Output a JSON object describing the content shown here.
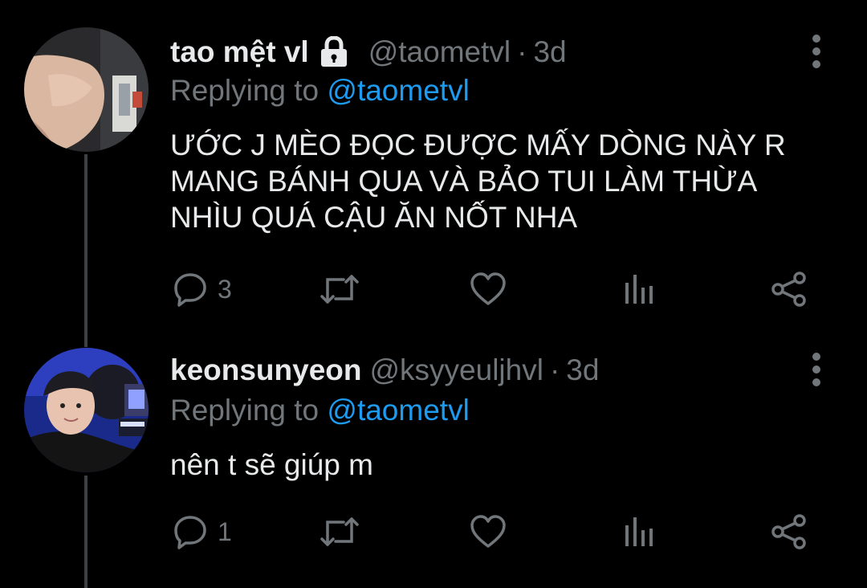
{
  "colors": {
    "background": "#000000",
    "text_primary": "#e7e9ea",
    "text_secondary": "#71767b",
    "accent": "#1d9bf0",
    "thread_line": "#3d4146"
  },
  "tweets": [
    {
      "display_name": "tao mệt vl",
      "locked": true,
      "handle": "@taometvl",
      "separator": "·",
      "timestamp": "3d",
      "replying_prefix": "Replying to",
      "replying_to": "@taometvl",
      "text_lines": [
        "ƯỚC J MÈO ĐỌC ĐƯỢC MẤY DÒNG NÀY R",
        "MANG BÁNH QUA VÀ BẢO TUI LÀM THỪA",
        "NHÌU QUÁ CẬU ĂN NỐT NHA"
      ],
      "reply_count": "3",
      "avatar_icon": "avatar-photo"
    },
    {
      "display_name": "keonsunyeon",
      "locked": false,
      "handle": "@ksyyeuljhvl",
      "separator": "·",
      "timestamp": "3d",
      "replying_prefix": "Replying to",
      "replying_to": "@taometvl",
      "text_lines": [
        "nên t sẽ giúp m"
      ],
      "reply_count": "1",
      "avatar_icon": "avatar-photo"
    }
  ],
  "icons": {
    "reply": "reply-icon",
    "retweet": "retweet-icon",
    "like": "heart-icon",
    "analytics": "analytics-icon",
    "share": "share-icon",
    "more": "more-vertical-icon",
    "lock": "lock-icon"
  }
}
